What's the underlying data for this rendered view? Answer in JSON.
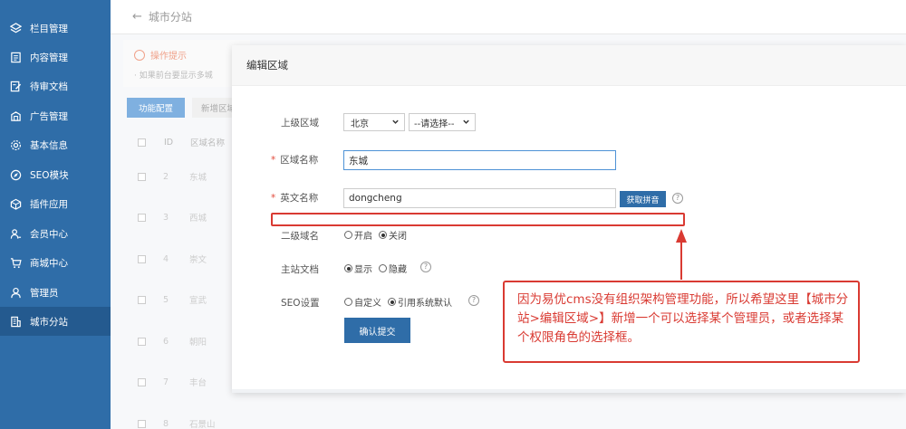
{
  "sidebar": {
    "items": [
      {
        "label": "栏目管理",
        "icon": "layers-icon"
      },
      {
        "label": "内容管理",
        "icon": "document-icon"
      },
      {
        "label": "待审文档",
        "icon": "edit-document-icon"
      },
      {
        "label": "广告管理",
        "icon": "ad-icon"
      },
      {
        "label": "基本信息",
        "icon": "gear-icon"
      },
      {
        "label": "SEO模块",
        "icon": "compass-icon"
      },
      {
        "label": "插件应用",
        "icon": "cube-icon"
      },
      {
        "label": "会员中心",
        "icon": "members-icon"
      },
      {
        "label": "商城中心",
        "icon": "cart-icon"
      },
      {
        "label": "管理员",
        "icon": "user-icon"
      },
      {
        "label": "城市分站",
        "icon": "building-icon",
        "active": true
      }
    ]
  },
  "header": {
    "back_symbol": "←",
    "title": "城市分站"
  },
  "tips": {
    "title": "操作提示",
    "line": "· 如果前台要显示多城"
  },
  "toolbar": {
    "func_label": "功能配置",
    "add_label": "新增区域"
  },
  "table": {
    "headers": {
      "id": "ID",
      "name": "区域名称"
    },
    "rows": [
      {
        "id": "2",
        "name": "东城"
      },
      {
        "id": "3",
        "name": "西城"
      },
      {
        "id": "4",
        "name": "崇文"
      },
      {
        "id": "5",
        "name": "宣武"
      },
      {
        "id": "6",
        "name": "朝阳"
      },
      {
        "id": "7",
        "name": "丰台"
      },
      {
        "id": "8",
        "name": "石景山"
      }
    ]
  },
  "modal": {
    "title": "编辑区域",
    "parent_region": {
      "label": "上级区域",
      "province": "北京",
      "city": "--请选择--"
    },
    "region_name": {
      "required_mark": "*",
      "label": "区域名称",
      "value": "东城"
    },
    "english_name": {
      "required_mark": "*",
      "label": "英文名称",
      "value": "dongcheng",
      "button": "获取拼音",
      "help": "?"
    },
    "subdomain": {
      "label": "二级域名",
      "options": [
        {
          "label": "开启",
          "checked": false
        },
        {
          "label": "关闭",
          "checked": true
        }
      ]
    },
    "main_docs": {
      "label": "主站文档",
      "options": [
        {
          "label": "显示",
          "checked": true
        },
        {
          "label": "隐藏",
          "checked": false
        }
      ],
      "help": "?"
    },
    "seo": {
      "label": "SEO设置",
      "options": [
        {
          "label": "自定义",
          "checked": false
        },
        {
          "label": "引用系统默认",
          "checked": true
        }
      ],
      "help": "?"
    },
    "submit_label": "确认提交"
  },
  "annotation": {
    "text": "因为易优cms没有组织架构管理功能，所以希望这里【城市分站>编辑区域>】新增一个可以选择某个管理员，或者选择某个权限角色的选择框。",
    "color": "#d93a32"
  }
}
